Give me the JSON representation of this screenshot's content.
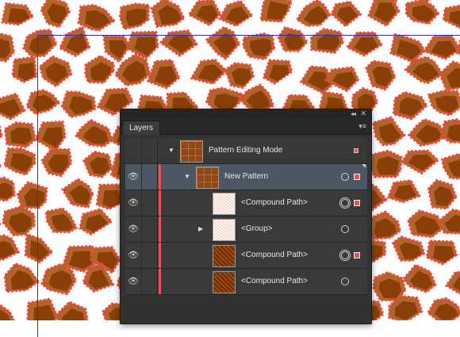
{
  "panel": {
    "tab_label": "Layers",
    "collapse_icon": "collapse-icon",
    "close_icon": "close-icon",
    "menu_icon": "panel-menu-icon"
  },
  "layers": [
    {
      "label": "Pattern Editing Mode",
      "thumb": "tile",
      "indent": 0,
      "disclosure": "expanded",
      "eye": false,
      "target": "none",
      "selected_marker": "small"
    },
    {
      "label": "New Pattern",
      "thumb": "tile",
      "indent": 1,
      "disclosure": "expanded",
      "eye": true,
      "target": "single",
      "selected_marker": "full",
      "selected": true
    },
    {
      "label": "<Compound Path>",
      "thumb": "light",
      "indent": 2,
      "disclosure": "none",
      "eye": true,
      "target": "double",
      "selected_marker": "full"
    },
    {
      "label": "<Group>",
      "thumb": "light",
      "indent": 2,
      "disclosure": "collapsed",
      "eye": true,
      "target": "single",
      "selected_marker": "none"
    },
    {
      "label": "<Compound Path>",
      "thumb": "brown",
      "indent": 2,
      "disclosure": "none",
      "eye": true,
      "target": "double",
      "selected_marker": "full"
    },
    {
      "label": "<Compound Path>",
      "thumb": "brown",
      "indent": 2,
      "disclosure": "none",
      "eye": true,
      "target": "single",
      "selected_marker": "none"
    }
  ],
  "colors": {
    "layer_color": "#e8525b",
    "pattern_fill": "#8b3f08",
    "pattern_highlight": "#b0652a",
    "path_outline": "#ff4040",
    "artboard_line": "#3a2aa8"
  }
}
